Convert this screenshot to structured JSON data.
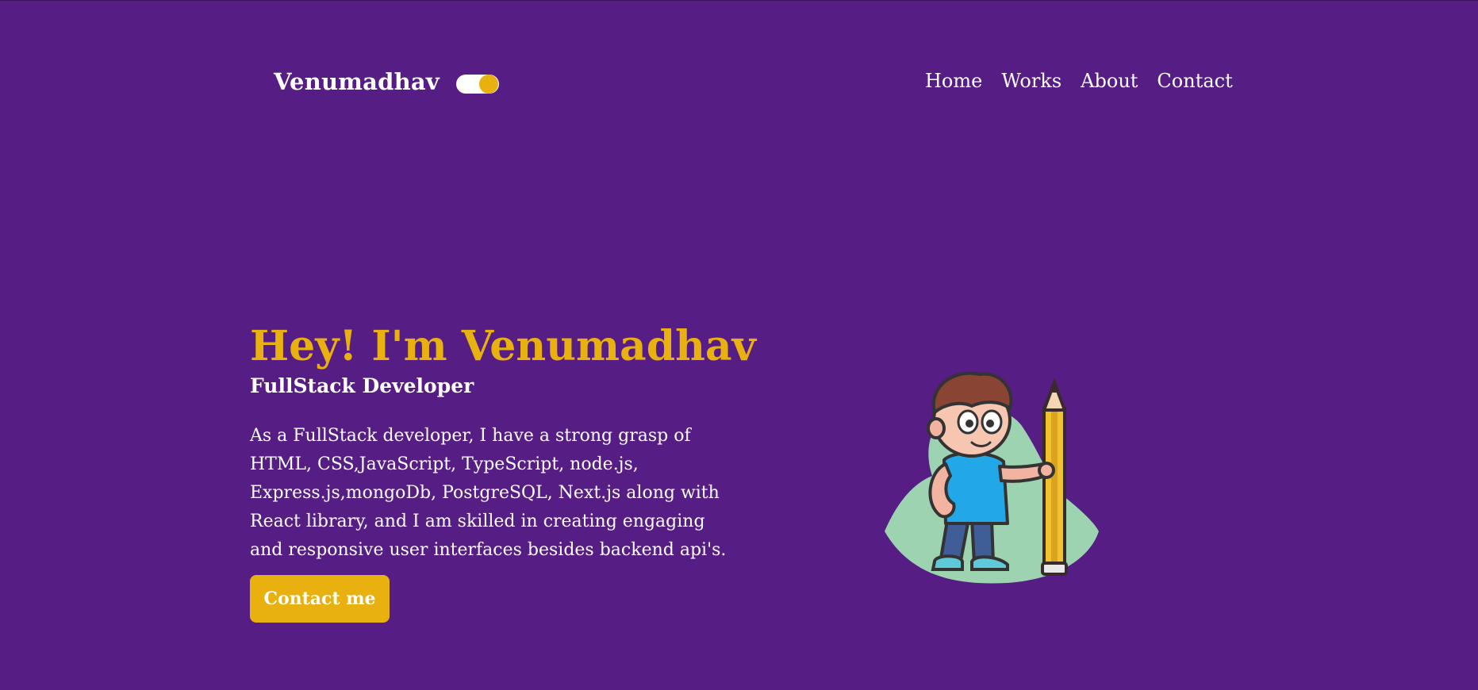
{
  "header": {
    "brand": "Venumadhav",
    "nav": [
      {
        "label": "Home"
      },
      {
        "label": "Works"
      },
      {
        "label": "About"
      },
      {
        "label": "Contact"
      }
    ]
  },
  "hero": {
    "title": "Hey! I'm Venumadhav",
    "subtitle": "FullStack Developer",
    "description_lines": [
      "As a FullStack developer, I have a strong grasp of",
      "HTML, CSS,JavaScript, TypeScript, node.js,",
      "Express.js,mongoDb, PostgreSQL, Next.js along with",
      "React library, and I am skilled in creating engaging",
      "and responsive user interfaces besides backend api's."
    ],
    "cta_label": "Contact me",
    "illustration": "cartoon-boy-with-pencil-icon"
  },
  "colors": {
    "background": "#561d85",
    "accent": "#e8b10f",
    "text": "#ffffff",
    "blob": "#9dd3b0"
  }
}
